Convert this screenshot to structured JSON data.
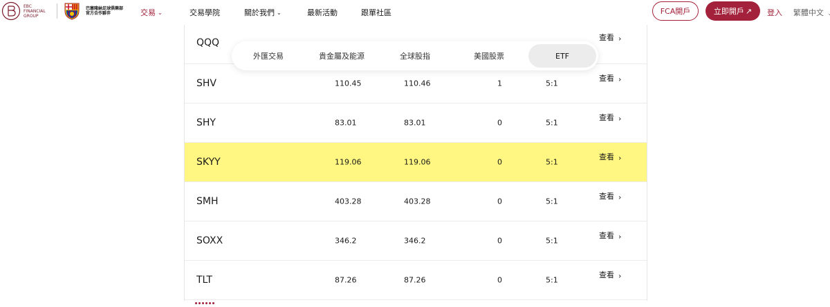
{
  "brand": {
    "ebc_text_lines": [
      "EBC",
      "FINANCIAL",
      "GROUP"
    ],
    "fcb_text_lines": [
      "巴塞隆納足球俱樂部",
      "官方合作夥伴"
    ]
  },
  "nav": {
    "items": [
      {
        "label": "交易",
        "active": true,
        "has_dropdown": true
      },
      {
        "label": "交易學院",
        "active": false,
        "has_dropdown": false
      },
      {
        "label": "關於我們",
        "active": false,
        "has_dropdown": true
      },
      {
        "label": "最新活動",
        "active": false,
        "has_dropdown": false
      },
      {
        "label": "跟單社區",
        "active": false,
        "has_dropdown": false
      }
    ],
    "fca_button": "FCA開戶",
    "open_button": "立即開戶",
    "open_button_icon": "arrow-up-right-icon",
    "login": "登入",
    "language": "繁體中文",
    "language_icon": "chevron-down-icon"
  },
  "tabs": {
    "items": [
      {
        "label": "外匯交易",
        "active": false
      },
      {
        "label": "貴金屬及能源",
        "active": false
      },
      {
        "label": "全球股指",
        "active": false
      },
      {
        "label": "美國股票",
        "active": false
      },
      {
        "label": "ETF",
        "active": true
      }
    ]
  },
  "table": {
    "view_label": "查看",
    "view_icon": "chevron-right-icon",
    "rows": [
      {
        "symbol": "QQQ",
        "bid": "",
        "ask": "",
        "spread": "",
        "leverage": "",
        "highlight": false
      },
      {
        "symbol": "SHV",
        "bid": "110.45",
        "ask": "110.46",
        "spread": "1",
        "leverage": "5:1",
        "highlight": false
      },
      {
        "symbol": "SHY",
        "bid": "83.01",
        "ask": "83.01",
        "spread": "0",
        "leverage": "5:1",
        "highlight": false
      },
      {
        "symbol": "SKYY",
        "bid": "119.06",
        "ask": "119.06",
        "spread": "0",
        "leverage": "5:1",
        "highlight": true
      },
      {
        "symbol": "SMH",
        "bid": "403.28",
        "ask": "403.28",
        "spread": "0",
        "leverage": "5:1",
        "highlight": false
      },
      {
        "symbol": "SOXX",
        "bid": "346.2",
        "ask": "346.2",
        "spread": "0",
        "leverage": "5:1",
        "highlight": false
      },
      {
        "symbol": "TLT",
        "bid": "87.26",
        "ask": "87.26",
        "spread": "0",
        "leverage": "5:1",
        "highlight": false
      }
    ]
  },
  "colors": {
    "brand": "#a3213a",
    "highlight_row": "#fff781",
    "active_tab": "#ececec"
  }
}
